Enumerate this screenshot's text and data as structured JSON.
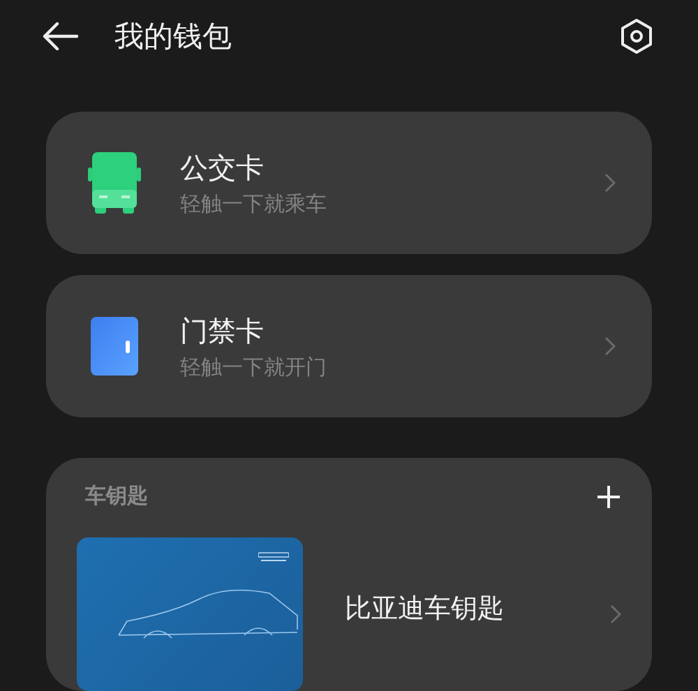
{
  "header": {
    "title": "我的钱包"
  },
  "cards": [
    {
      "kind": "bus",
      "title": "公交卡",
      "subtitle": "轻触一下就乘车"
    },
    {
      "kind": "door",
      "title": "门禁卡",
      "subtitle": "轻触一下就开门"
    }
  ],
  "car_keys": {
    "heading": "车钥匙",
    "keys": [
      {
        "name": "比亚迪车钥匙"
      }
    ]
  }
}
